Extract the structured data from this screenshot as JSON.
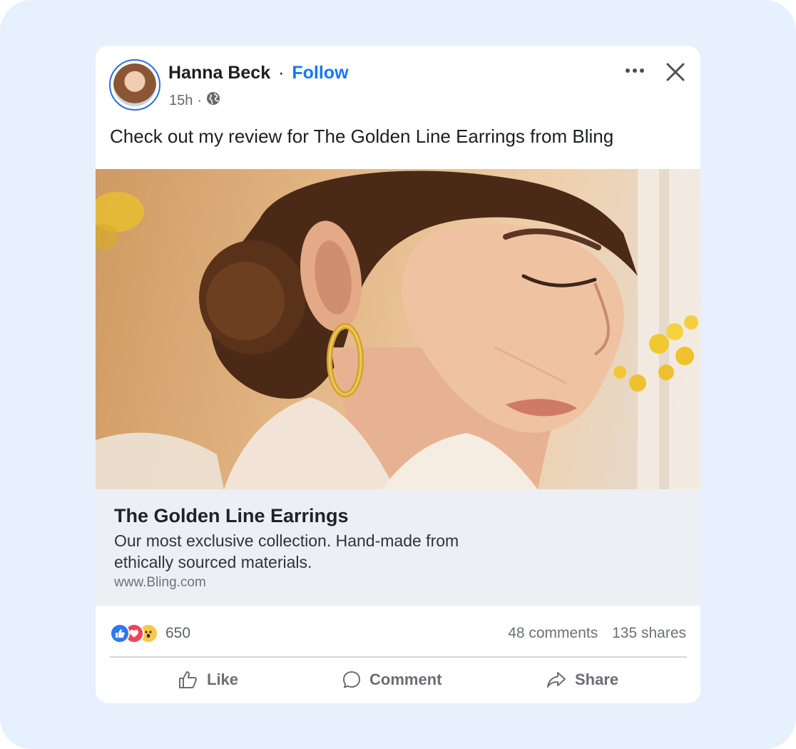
{
  "post": {
    "author": "Hanna Beck",
    "separator": "·",
    "follow_label": "Follow",
    "timestamp": "15h",
    "meta_separator": "·",
    "audience_icon": "globe-icon",
    "text": "Check out my review for The Golden Line Earrings from Bling"
  },
  "header_actions": {
    "more_icon": "more-horizontal-icon",
    "close_icon": "close-icon"
  },
  "image": {
    "subject": "photo-woman-gold-hoop-earring"
  },
  "link_preview": {
    "title": "The Golden Line Earrings",
    "description": "Our most exclusive collection. Hand-made from ethically sourced materials.",
    "url": "www.Bling.com"
  },
  "stats": {
    "reactions": [
      "like-reaction-icon",
      "love-reaction-icon",
      "wow-reaction-icon"
    ],
    "reaction_count": "650",
    "comments": "48 comments",
    "shares": "135 shares"
  },
  "actions": {
    "like_label": "Like",
    "comment_label": "Comment",
    "share_label": "Share"
  },
  "colors": {
    "accent": "#1877f2",
    "page_background": "#e7f0fd",
    "preview_background": "#ecf0f4"
  }
}
